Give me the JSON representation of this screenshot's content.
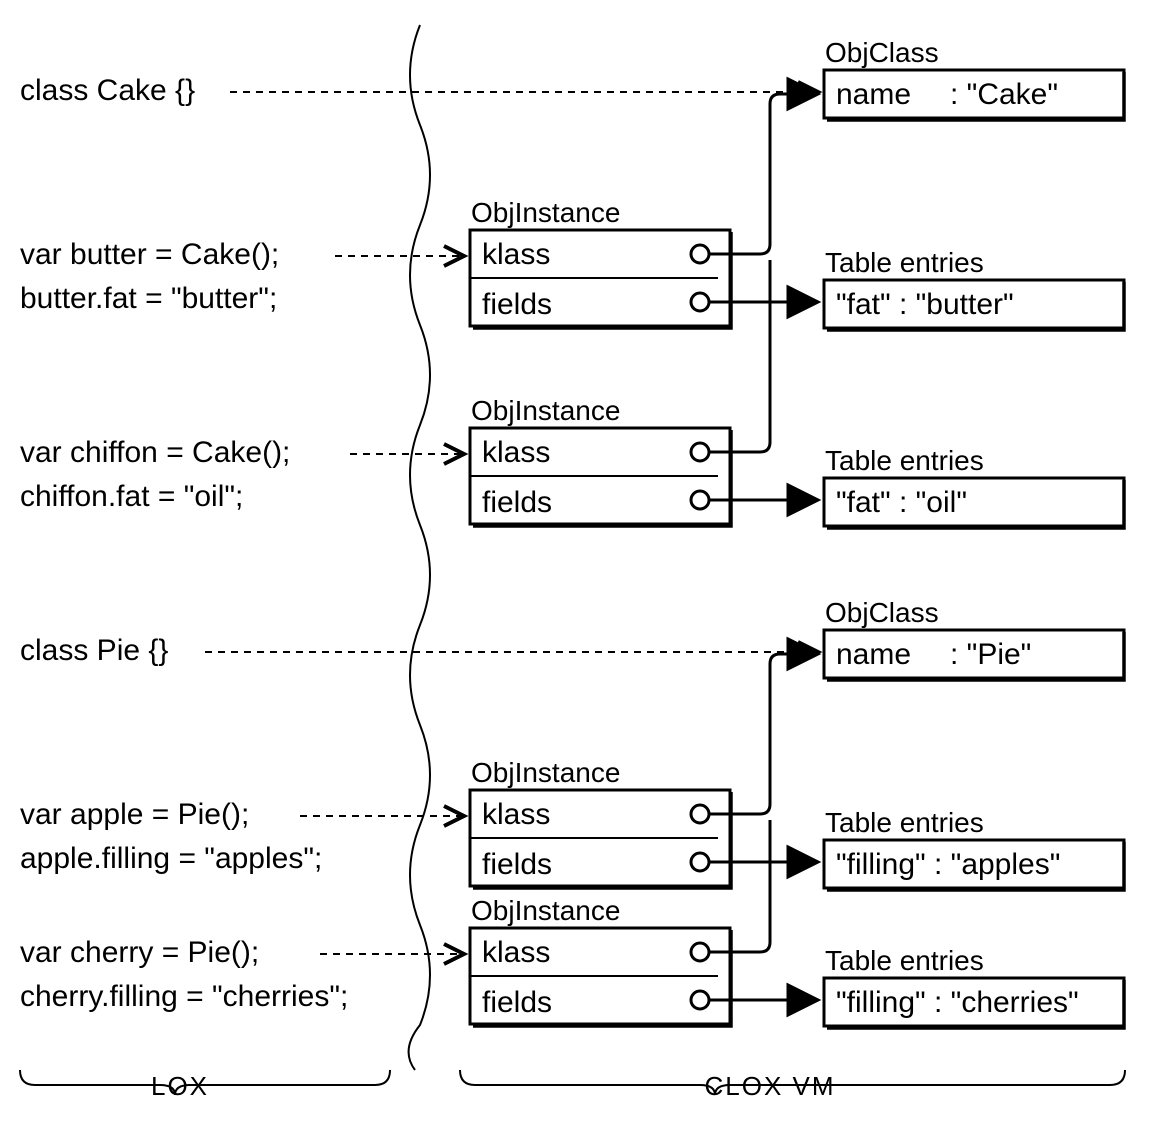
{
  "left_label": "LOX",
  "right_label": "CLOX VM",
  "code": {
    "line1": "class Cake {}",
    "line2": "var butter = Cake();",
    "line3": "butter.fat = \"butter\";",
    "line4": "var chiffon = Cake();",
    "line5": "chiffon.fat = \"oil\";",
    "line6": "class Pie {}",
    "line7": "var apple = Pie();",
    "line8": "apple.filling = \"apples\";",
    "line9": "var cherry = Pie();",
    "line10": "cherry.filling = \"cherries\";"
  },
  "headers": {
    "objclass": "ObjClass",
    "objinstance": "ObjInstance",
    "table_entries": "Table entries"
  },
  "fields": {
    "name": "name",
    "klass": "klass",
    "fields": "fields"
  },
  "classes": {
    "cake_name": ": \"Cake\"",
    "pie_name": ": \"Pie\""
  },
  "entries": {
    "butter": "\"fat\"   : \"butter\"",
    "oil": "\"fat\"   : \"oil\"",
    "apples": "\"filling\" : \"apples\"",
    "cherries": "\"filling\" : \"cherries\""
  }
}
